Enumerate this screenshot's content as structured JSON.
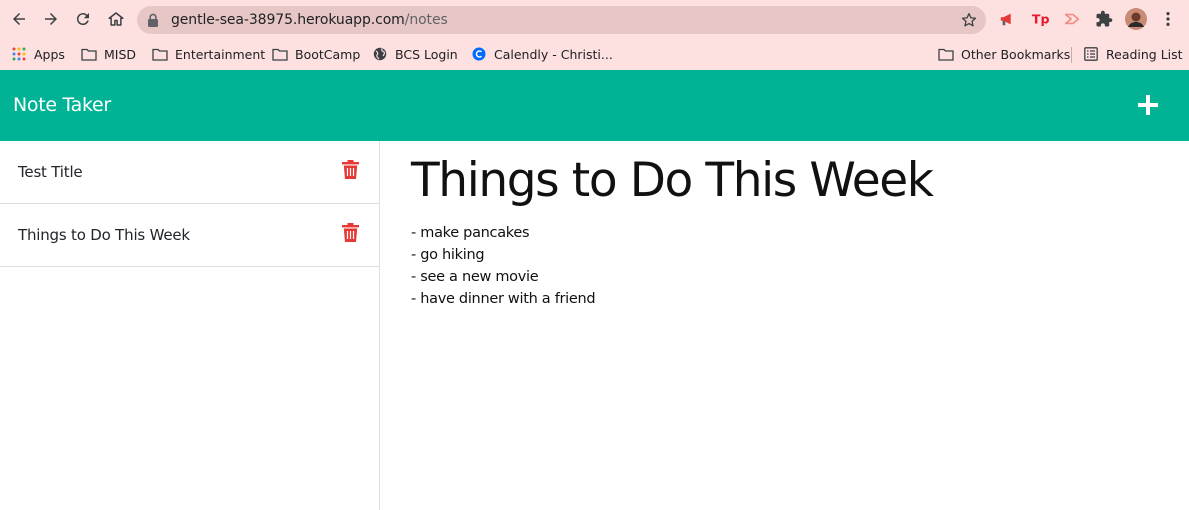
{
  "browser": {
    "url_host": "gentle-sea-38975.herokuapp.com",
    "url_path": "/notes",
    "bookmarks": [
      {
        "label": "Apps",
        "icon": "apps-grid-icon"
      },
      {
        "label": "MISD",
        "icon": "folder-icon"
      },
      {
        "label": "Entertainment",
        "icon": "folder-icon"
      },
      {
        "label": "BootCamp",
        "icon": "folder-icon"
      },
      {
        "label": "BCS Login",
        "icon": "globe-icon"
      },
      {
        "label": "Calendly - Christi...",
        "icon": "calendly-icon"
      }
    ],
    "right_bookmarks": [
      {
        "label": "Other Bookmarks",
        "icon": "folder-icon"
      },
      {
        "label": "Reading List",
        "icon": "reading-list-icon"
      }
    ],
    "colors": {
      "chrome_bg": "#fde0e0",
      "omnibox_bg": "#e7c6c6"
    }
  },
  "app": {
    "title": "Note Taker",
    "colors": {
      "header": "#00b395",
      "trash": "#e53935"
    }
  },
  "notes": [
    {
      "title": "Test Title"
    },
    {
      "title": "Things to Do This Week"
    }
  ],
  "active_note": {
    "title": "Things to Do This Week",
    "lines": [
      "- make pancakes",
      "- go hiking",
      "- see a new movie",
      "- have dinner with a friend"
    ]
  }
}
